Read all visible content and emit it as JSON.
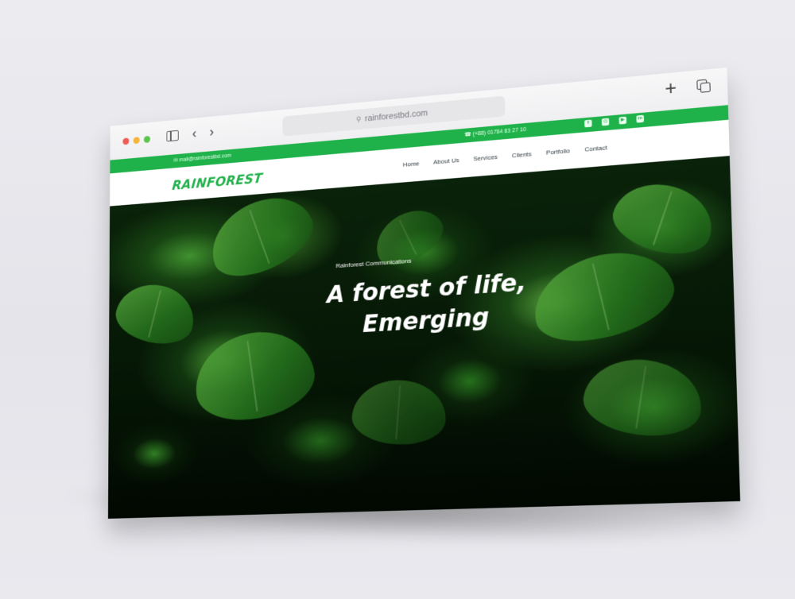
{
  "browser": {
    "url": "rainforestbd.com",
    "url_icon": "search-icon",
    "nav_icons": {
      "back": "‹",
      "forward": "›"
    },
    "new_tab_label": "+"
  },
  "topbar": {
    "email": "mail@rainforestbd.com",
    "phone": "+88) 01784 83 27 10",
    "social": [
      "f",
      "◎",
      "▶",
      "in"
    ],
    "color": "#1fb24a"
  },
  "nav": {
    "logo": "RAINFOREST",
    "items": [
      "Home",
      "About Us",
      "Services",
      "Clients",
      "Portfolio",
      "Contact"
    ]
  },
  "hero": {
    "subtitle": "Rainforest Communications",
    "title_line1": "A forest of life,",
    "title_line2": "Emerging"
  },
  "colors": {
    "brand_green": "#22b14c",
    "hero_text": "#ffffff"
  }
}
